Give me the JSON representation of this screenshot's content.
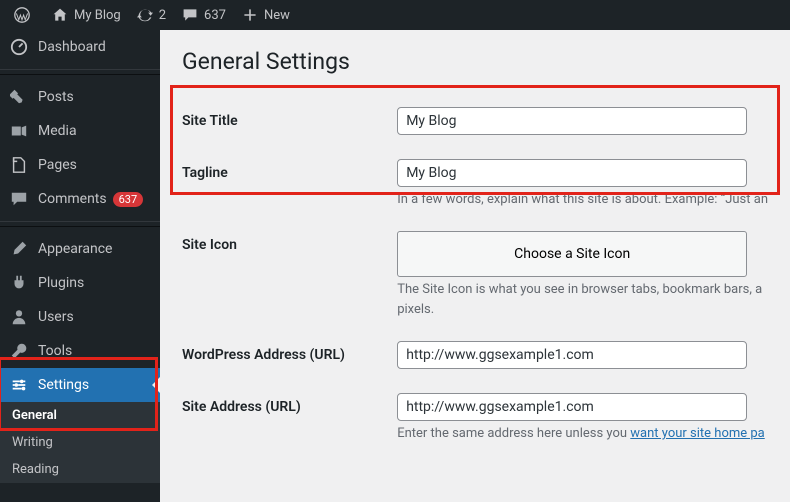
{
  "adminbar": {
    "site_name": "My Blog",
    "updates_count": "2",
    "comments_count": "637",
    "new_label": "New"
  },
  "sidebar": {
    "items": [
      {
        "label": "Dashboard",
        "icon": "dashboard"
      },
      {
        "label": "Posts",
        "icon": "pin"
      },
      {
        "label": "Media",
        "icon": "media"
      },
      {
        "label": "Pages",
        "icon": "page"
      },
      {
        "label": "Comments",
        "icon": "comment",
        "badge": "637"
      },
      {
        "label": "Appearance",
        "icon": "brush"
      },
      {
        "label": "Plugins",
        "icon": "plug"
      },
      {
        "label": "Users",
        "icon": "user"
      },
      {
        "label": "Tools",
        "icon": "wrench"
      },
      {
        "label": "Settings",
        "icon": "sliders",
        "active": true
      }
    ],
    "submenu": {
      "items": [
        {
          "label": "General",
          "current": true
        },
        {
          "label": "Writing"
        },
        {
          "label": "Reading"
        }
      ]
    }
  },
  "page": {
    "title": "General Settings",
    "fields": {
      "site_title": {
        "label": "Site Title",
        "value": "My Blog"
      },
      "tagline": {
        "label": "Tagline",
        "value": "My Blog",
        "description": "In a few words, explain what this site is about. Example: “Just an"
      },
      "site_icon": {
        "label": "Site Icon",
        "button": "Choose a Site Icon",
        "description": "The Site Icon is what you see in browser tabs, bookmark bars, a",
        "description2": "pixels."
      },
      "wp_url": {
        "label": "WordPress Address (URL)",
        "value": "http://www.ggsexample1.com"
      },
      "site_url": {
        "label": "Site Address (URL)",
        "value": "http://www.ggsexample1.com",
        "description_pre": "Enter the same address here unless you ",
        "description_link": "want your site home pa"
      }
    }
  }
}
